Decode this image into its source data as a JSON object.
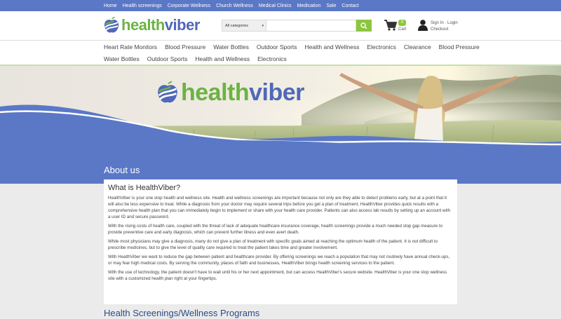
{
  "topbar": {
    "links": [
      "Home",
      "Health screenings",
      "Corporate Wellness",
      "Church Wellness",
      "Medical Clinics",
      "Medication",
      "Sale",
      "Contact"
    ]
  },
  "header": {
    "logo": {
      "part1": "health",
      "part2": "viber"
    },
    "search": {
      "category": "All categories",
      "placeholder": ""
    },
    "cart": {
      "count": "0",
      "label": "Cart"
    },
    "account": {
      "sign_in": "Sign In",
      "login": "Login",
      "checkout": "Checkout"
    }
  },
  "nav": {
    "row1": [
      "Heart Rate Monitors",
      "Blood Pressure",
      "Water Bottles",
      "Outdoor Sports",
      "Health and Wellness",
      "Electronics",
      "Clearance",
      "Blood Pressure"
    ],
    "row2": [
      "Water Bottles",
      "Outdoor Sports",
      "Health and Wellness",
      "Electronics"
    ]
  },
  "hero": {
    "logo_part1": "health",
    "logo_part2": "viber"
  },
  "colors": {
    "brand_blue": "#5b78c7",
    "brand_green": "#8cc63f",
    "logo_blue": "#5068b8",
    "logo_green": "#6bb344"
  },
  "about": {
    "heading": "About us",
    "card_title": "What is HealthViber?",
    "paragraphs": [
      "HealthViber is your one stop health and wellness site. Health and wellness screenings are important because not only are they able to detect problems early, but at a point that it will also be less expensive to treat. While a diagnosis from your doctor may require several trips before you get a plan of treatment, HealthViber provides quick results with a comprehensive health plan that you can immediately begin to implement or share with your health care provider. Patients can also access lab results by setting up an account with a user ID and secure password.",
      "With the rising costs of health care, coupled with the threat of lack of adequate healthcare insurance coverage, health screenings provide a much needed stop gap measure to provide preventive care and early diagnosis, which can prevent further illness and even avert death.",
      "While most physicians may give a diagnosis, many do not give a plan of treatment with specific goals aimed at reaching the optimum health of the patient. It is not difficult to prescribe medicines, but to give the level of quality care required to treat the patient takes time and greater involvement.",
      "With HealthViber we want to reduce the gap between patient and healthcare provider. By offering screenings we reach a population that may not routinely have annual check-ups, or may fear high medical costs. By serving the community, places of faith and businesses, HealthViber brings health screening services to the patient.",
      "With the use of technology, the patient doesn't have to wait until his or her next appointment, but can access HealthViber's secure website. HealthViber is your one stop wellness site with a customized health plan right at your fingertips."
    ]
  },
  "section2": {
    "heading": "Health Screenings/Wellness Programs"
  }
}
